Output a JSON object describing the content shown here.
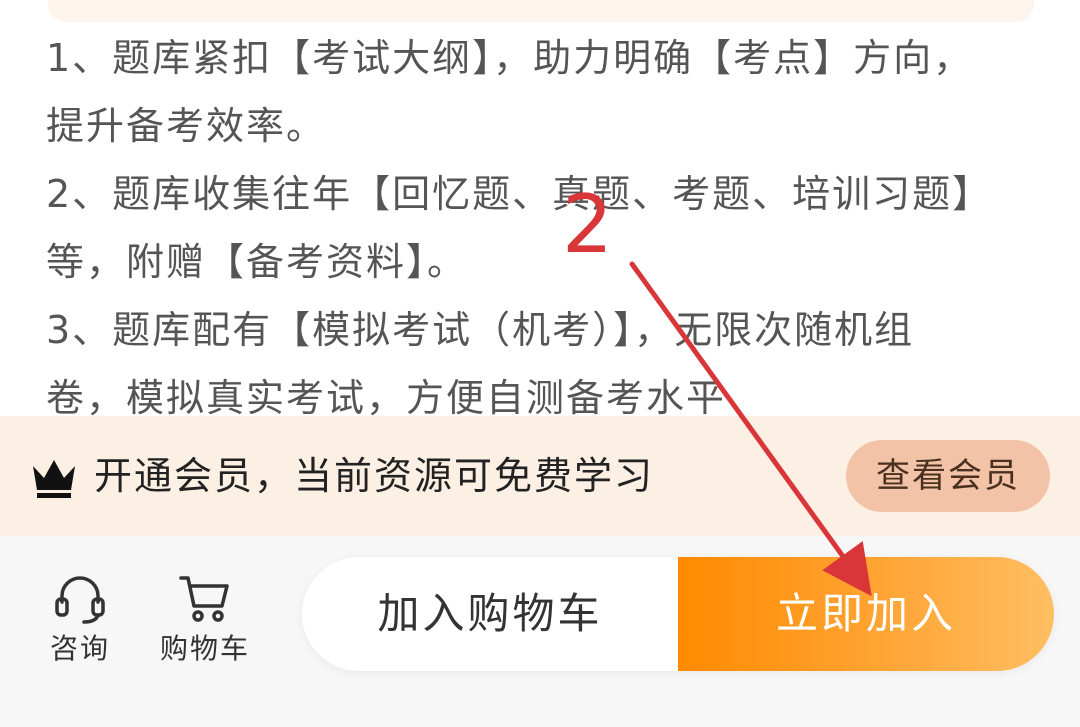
{
  "description": {
    "lines": [
      "1、题库紧扣【考试大纲】，助力明确【考点】方向，",
      "提升备考效率。",
      "2、题库收集往年【回忆题、真题、考题、培训习题】",
      "等，附赠【备考资料】。",
      "3、题库配有【模拟考试（机考）】，无限次随机组",
      "卷，模拟真实考试，方便自测备考水平"
    ]
  },
  "membership": {
    "icon": "crown-icon",
    "text": "开通会员，当前资源可免费学习",
    "button_label": "查看会员",
    "bar_color": "#fcefe4",
    "button_color": "#f2c3a6"
  },
  "bottom_nav": {
    "consult": {
      "icon": "headset-icon",
      "label": "咨询"
    },
    "cart": {
      "icon": "cart-icon",
      "label": "购物车"
    }
  },
  "actions": {
    "add_to_cart_label": "加入购物车",
    "join_now_label": "立即加入",
    "accent_color": "#ff8a00"
  },
  "annotation": {
    "step_number": "2",
    "color": "#d9363a"
  }
}
